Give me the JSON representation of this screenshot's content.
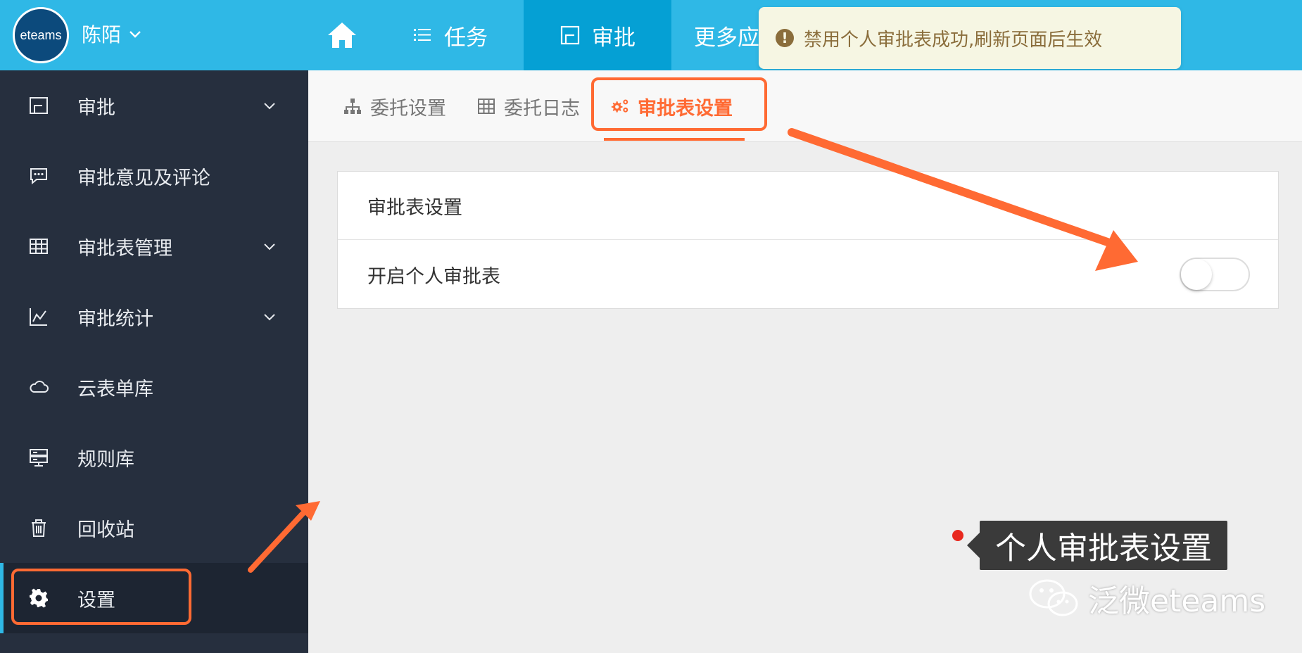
{
  "header": {
    "logo_text": "eteams",
    "user_name": "陈陌",
    "nav": {
      "tasks": "任务",
      "approve": "审批",
      "more": "更多应"
    }
  },
  "toast": {
    "message": "禁用个人审批表成功,刷新页面后生效",
    "icon": "exclamation-icon"
  },
  "sidebar": {
    "items": [
      {
        "label": "审批",
        "icon": "approve-icon"
      },
      {
        "label": "审批意见及评论",
        "icon": "comment-icon"
      },
      {
        "label": "审批表管理",
        "icon": "grid-icon"
      },
      {
        "label": "审批统计",
        "icon": "chart-icon"
      },
      {
        "label": "云表单库",
        "icon": "cloud-icon"
      },
      {
        "label": "规则库",
        "icon": "server-icon"
      },
      {
        "label": "回收站",
        "icon": "trash-icon"
      },
      {
        "label": "设置",
        "icon": "gear-icon"
      }
    ]
  },
  "subtabs": {
    "delegate": "委托设置",
    "delegate_log": "委托日志",
    "form_settings": "审批表设置"
  },
  "panel": {
    "title": "审批表设置",
    "personal_label": "开启个人审批表",
    "personal_enabled": false
  },
  "annotation": {
    "caption": "个人审批表设置",
    "watermark": "泛微eteams",
    "accent": "#ff6a33"
  }
}
